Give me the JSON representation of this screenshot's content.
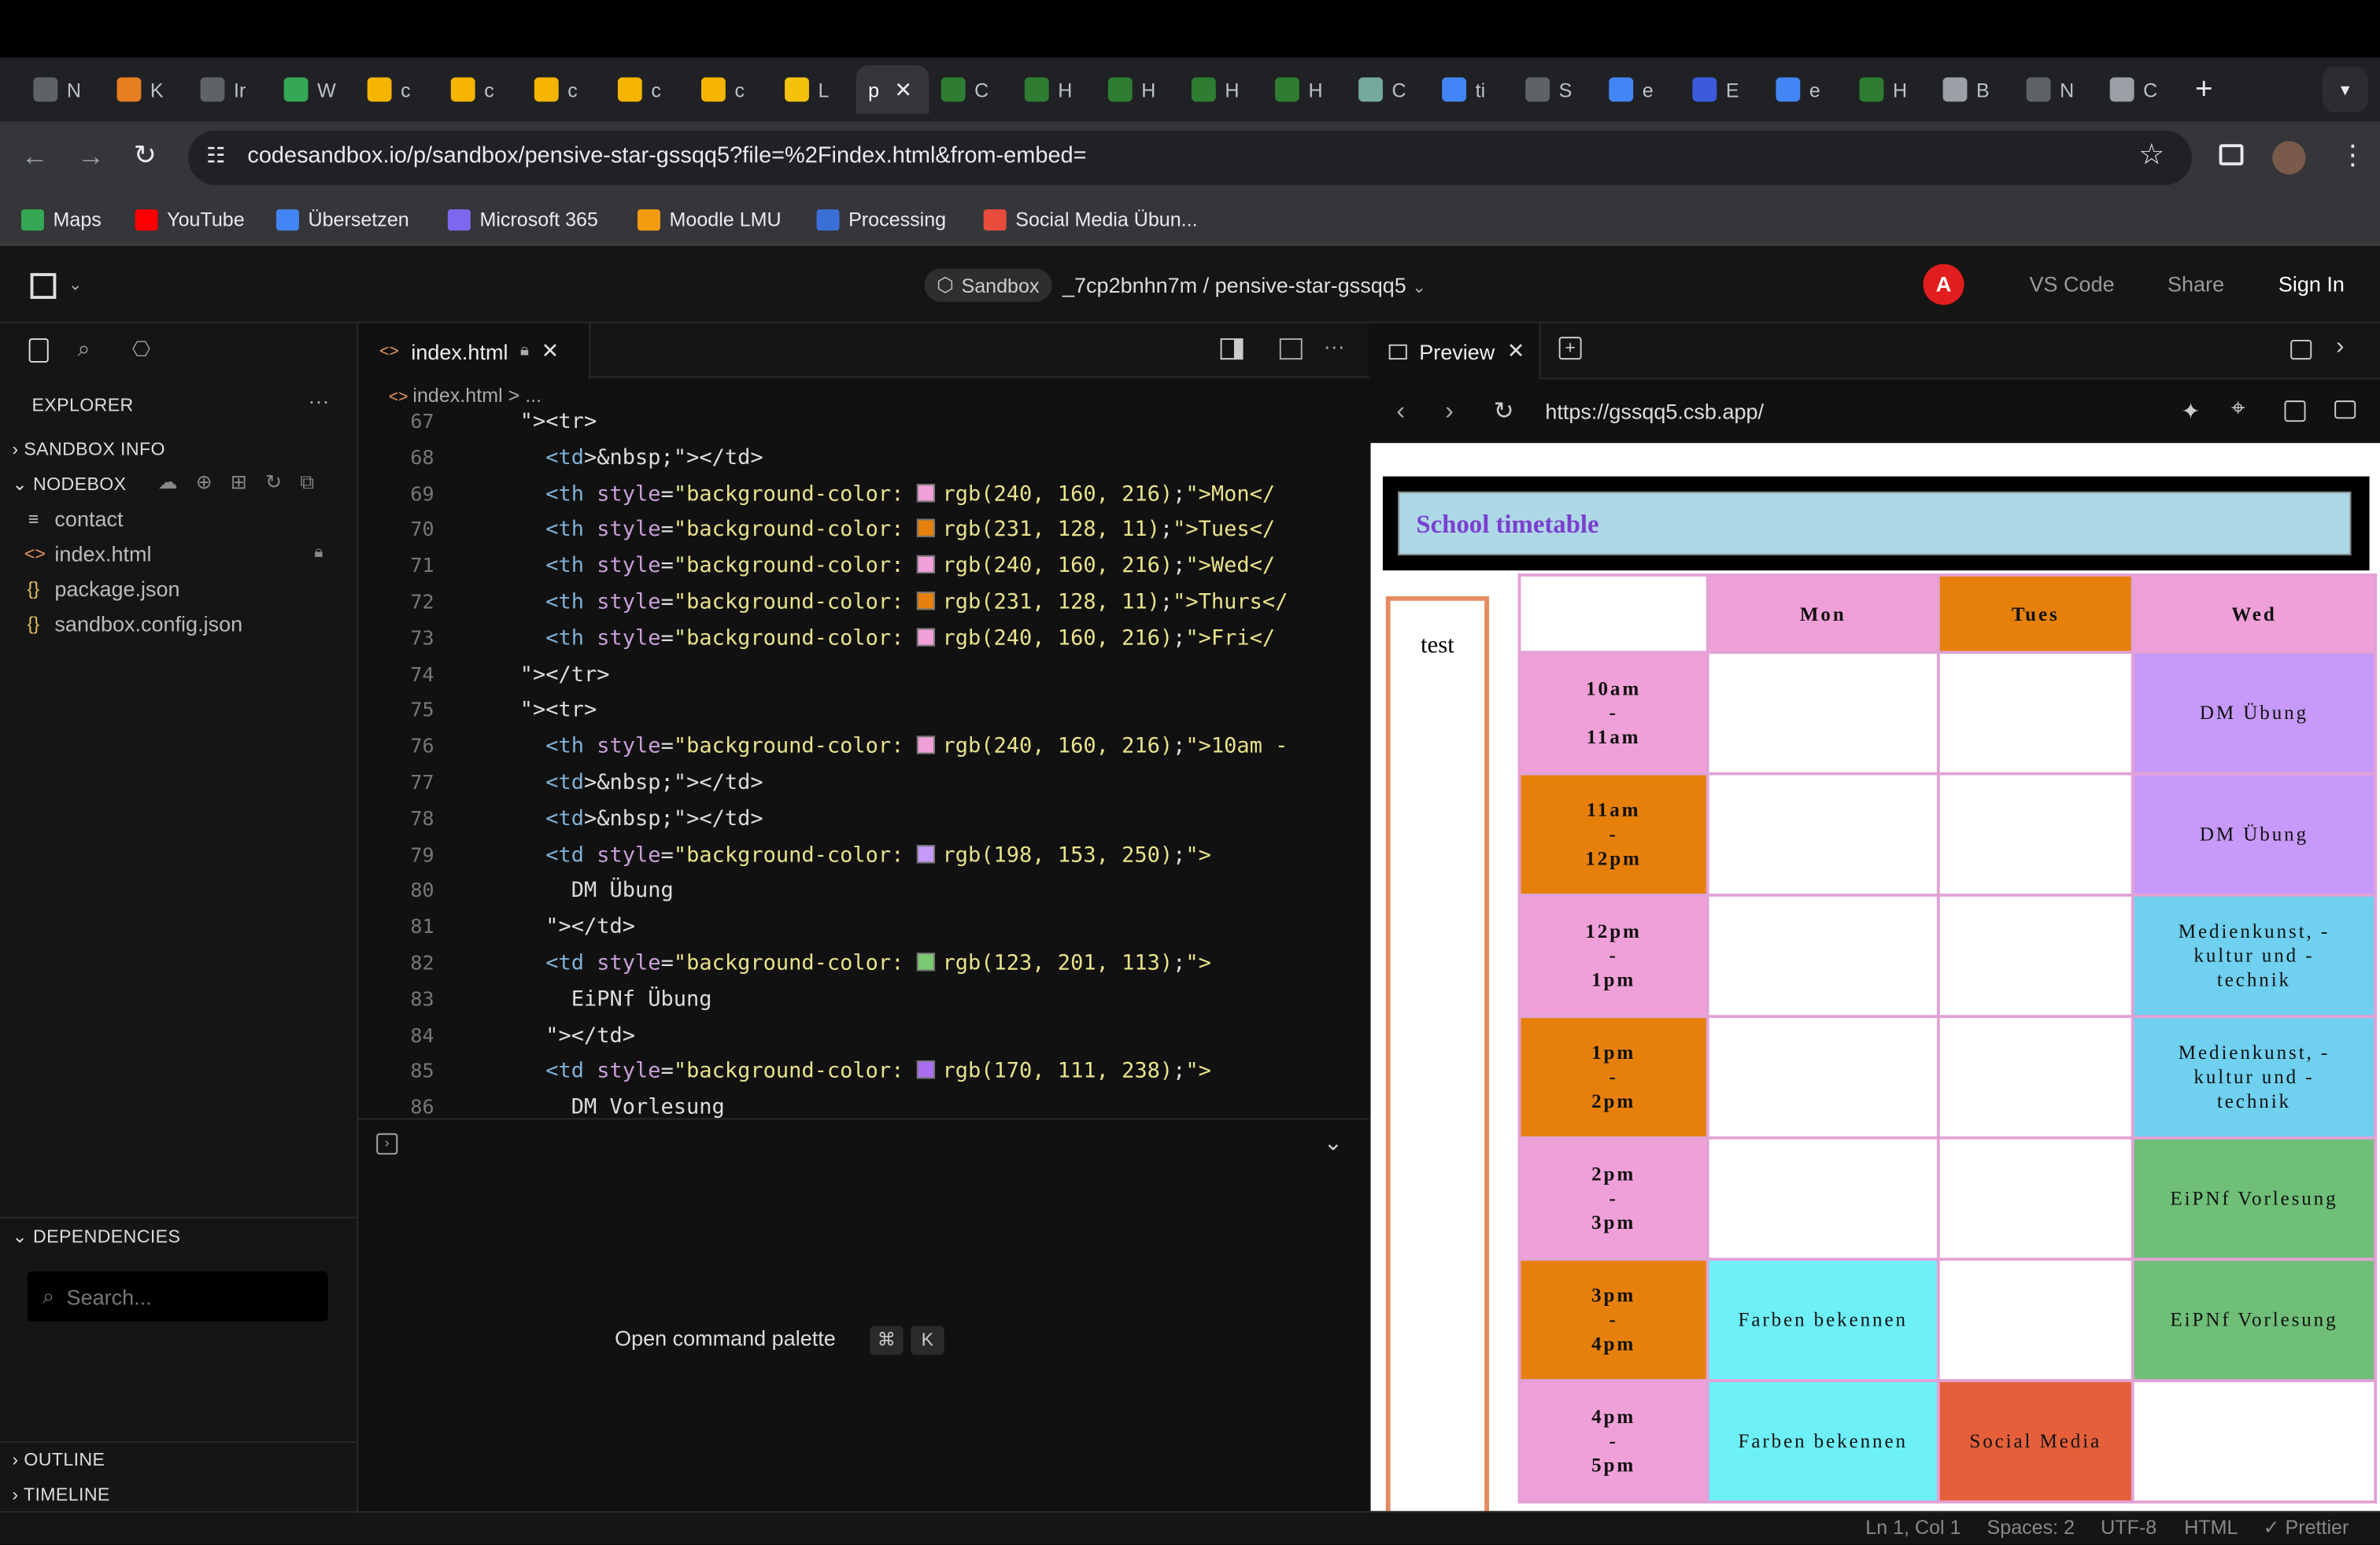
{
  "browser": {
    "tabs": [
      {
        "letter": "N",
        "color": "#5f6368"
      },
      {
        "letter": "K",
        "color": "#e67e22"
      },
      {
        "letter": "Ir",
        "color": "#5f6368"
      },
      {
        "letter": "W",
        "color": "#34a853"
      },
      {
        "letter": "c",
        "color": "#f4b400"
      },
      {
        "letter": "c",
        "color": "#f4b400"
      },
      {
        "letter": "c",
        "color": "#f4b400"
      },
      {
        "letter": "c",
        "color": "#f4b400"
      },
      {
        "letter": "c",
        "color": "#f4b400"
      },
      {
        "letter": "L",
        "color": "#f4c20d"
      },
      {
        "letter": "C",
        "color": "#2e7d32"
      },
      {
        "letter": "H",
        "color": "#2e7d32"
      },
      {
        "letter": "H",
        "color": "#2e7d32"
      },
      {
        "letter": "H",
        "color": "#2e7d32"
      },
      {
        "letter": "H",
        "color": "#2e7d32"
      },
      {
        "letter": "C",
        "color": "#74aa9c"
      },
      {
        "letter": "ti",
        "color": "#4285f4"
      },
      {
        "letter": "S",
        "color": "#5f6368"
      },
      {
        "letter": "e",
        "color": "#4285f4"
      },
      {
        "letter": "E",
        "color": "#3b5bdb"
      },
      {
        "letter": "e",
        "color": "#4285f4"
      },
      {
        "letter": "H",
        "color": "#2e7d32"
      },
      {
        "letter": "B",
        "color": "#9aa0a6"
      },
      {
        "letter": "N",
        "color": "#5f6368"
      },
      {
        "letter": "C",
        "color": "#9aa0a6"
      }
    ],
    "active_tab_letter": "p",
    "url": "codesandbox.io/p/sandbox/pensive-star-gssqq5?file=%2Findex.html&from-embed=",
    "bookmarks": [
      {
        "label": "Maps",
        "color": "#34a853"
      },
      {
        "label": "YouTube",
        "color": "#ff0000"
      },
      {
        "label": "Übersetzen",
        "color": "#4285f4"
      },
      {
        "label": "Microsoft 365",
        "color": "#7b68ee"
      },
      {
        "label": "Moodle LMU",
        "color": "#f39c12"
      },
      {
        "label": "Processing",
        "color": "#3b6fd8"
      },
      {
        "label": "Social Media Übun...",
        "color": "#e74c3c"
      }
    ]
  },
  "header": {
    "sandbox_label": "Sandbox",
    "path": "_7cp2bnhn7m / pensive-star-gssqq5",
    "avatar_letter": "A",
    "vscode": "VS Code",
    "share": "Share",
    "signin": "Sign In"
  },
  "sidebar": {
    "explorer": "EXPLORER",
    "sandbox_info": "SANDBOX INFO",
    "nodebox": "NODEBOX",
    "files": [
      {
        "name": "contact",
        "icon": "≡"
      },
      {
        "name": "index.html",
        "icon": "<>"
      },
      {
        "name": "package.json",
        "icon": "{}"
      },
      {
        "name": "sandbox.config.json",
        "icon": "{}"
      }
    ],
    "dependencies": "DEPENDENCIES",
    "search_placeholder": "Search...",
    "outline": "OUTLINE",
    "timeline": "TIMELINE"
  },
  "editor": {
    "tab": "index.html",
    "breadcrumb": "index.html > ...",
    "lines": [
      {
        "n": "67",
        "indent": "      ",
        "html": "tr-open"
      },
      {
        "n": "68",
        "text": "        <td>&nbsp;</td>"
      },
      {
        "n": "69",
        "text": "        <th style=\"background-color: ",
        "color": "rgb(240, 160, 216)",
        "tail": ";\">Mon</"
      },
      {
        "n": "70",
        "text": "        <th style=\"background-color: ",
        "color": "rgb(231, 128, 11)",
        "tail": ";\">Tues</"
      },
      {
        "n": "71",
        "text": "        <th style=\"background-color: ",
        "color": "rgb(240, 160, 216)",
        "tail": ";\">Wed</"
      },
      {
        "n": "72",
        "text": "        <th style=\"background-color: ",
        "color": "rgb(231, 128, 11)",
        "tail": ";\">Thurs</"
      },
      {
        "n": "73",
        "text": "        <th style=\"background-color: ",
        "color": "rgb(240, 160, 216)",
        "tail": ";\">Fri</"
      },
      {
        "n": "74",
        "text": "      </tr>"
      },
      {
        "n": "75",
        "text": "      <tr>"
      },
      {
        "n": "76",
        "text": "        <th style=\"background-color: ",
        "color": "rgb(240, 160, 216)",
        "tail": ";\">10am -"
      },
      {
        "n": "77",
        "text": "        <td>&nbsp;</td>"
      },
      {
        "n": "78",
        "text": "        <td>&nbsp;</td>"
      },
      {
        "n": "79",
        "text": "        <td style=\"background-color: ",
        "color": "rgb(198, 153, 250)",
        "tail": ";\">"
      },
      {
        "n": "80",
        "text": "          DM Übung"
      },
      {
        "n": "81",
        "text": "        </td>"
      },
      {
        "n": "82",
        "text": "        <td style=\"background-color: ",
        "color": "rgb(123, 201, 113)",
        "tail": ";\">"
      },
      {
        "n": "83",
        "text": "          EiPNf Übung"
      },
      {
        "n": "84",
        "text": "        </td>"
      },
      {
        "n": "85",
        "text": "        <td style=\"background-color: ",
        "color": "rgb(170, 111, 238)",
        "tail": ";\">"
      },
      {
        "n": "86",
        "text": "          DM Vorlesung"
      }
    ],
    "command_palette": "Open command palette",
    "shortcut": [
      "⌘",
      "K"
    ]
  },
  "preview": {
    "tab": "Preview",
    "url": "https://gssqq5.csb.app/",
    "page": {
      "title": "School timetable",
      "aside": "test",
      "headers": [
        {
          "label": "",
          "color": "#ffffff"
        },
        {
          "label": "Mon",
          "color": "#f0a0d8"
        },
        {
          "label": "Tues",
          "color": "#e7800b"
        },
        {
          "label": "Wed",
          "color": "#f0a0d8"
        }
      ],
      "rows": [
        {
          "time": [
            "10am",
            "-",
            "11am"
          ],
          "time_color": "#f0a0d8",
          "cells": [
            {
              "t": "",
              "c": "#ffffff"
            },
            {
              "t": "",
              "c": "#ffffff"
            },
            {
              "t": "DM Übung",
              "c": "#c699fa"
            }
          ]
        },
        {
          "time": [
            "11am",
            "-",
            "12pm"
          ],
          "time_color": "#e7800b",
          "cells": [
            {
              "t": "",
              "c": "#ffffff"
            },
            {
              "t": "",
              "c": "#ffffff"
            },
            {
              "t": "DM Übung",
              "c": "#c699fa"
            }
          ]
        },
        {
          "time": [
            "12pm",
            "-",
            "1pm"
          ],
          "time_color": "#f0a0d8",
          "cells": [
            {
              "t": "",
              "c": "#ffffff"
            },
            {
              "t": "",
              "c": "#ffffff"
            },
            {
              "t": "Medienkunst, -kultur und -technik",
              "c": "#6fd0f0"
            }
          ]
        },
        {
          "time": [
            "1pm",
            "-",
            "2pm"
          ],
          "time_color": "#e7800b",
          "cells": [
            {
              "t": "",
              "c": "#ffffff"
            },
            {
              "t": "",
              "c": "#ffffff"
            },
            {
              "t": "Medienkunst, -kultur und -technik",
              "c": "#6fd0f0"
            }
          ]
        },
        {
          "time": [
            "2pm",
            "-",
            "3pm"
          ],
          "time_color": "#f0a0d8",
          "cells": [
            {
              "t": "",
              "c": "#ffffff"
            },
            {
              "t": "",
              "c": "#ffffff"
            },
            {
              "t": "EiPNf Vorlesung",
              "c": "#6fbf78"
            }
          ]
        },
        {
          "time": [
            "3pm",
            "-",
            "4pm"
          ],
          "time_color": "#e7800b",
          "cells": [
            {
              "t": "Farben bekennen",
              "c": "#6ef0f8"
            },
            {
              "t": "",
              "c": "#ffffff"
            },
            {
              "t": "EiPNf Vorlesung",
              "c": "#6fbf78"
            }
          ]
        },
        {
          "time": [
            "4pm",
            "-",
            "5pm"
          ],
          "time_color": "#f0a0d8",
          "cells": [
            {
              "t": "Farben bekennen",
              "c": "#6ef0f8"
            },
            {
              "t": "Social Media",
              "c": "#e5603a"
            },
            {
              "t": "",
              "c": "#ffffff"
            }
          ]
        }
      ]
    }
  },
  "statusbar": {
    "pos": "Ln 1, Col 1",
    "spaces": "Spaces: 2",
    "enc": "UTF-8",
    "lang": "HTML",
    "fmt": "✓ Prettier"
  }
}
